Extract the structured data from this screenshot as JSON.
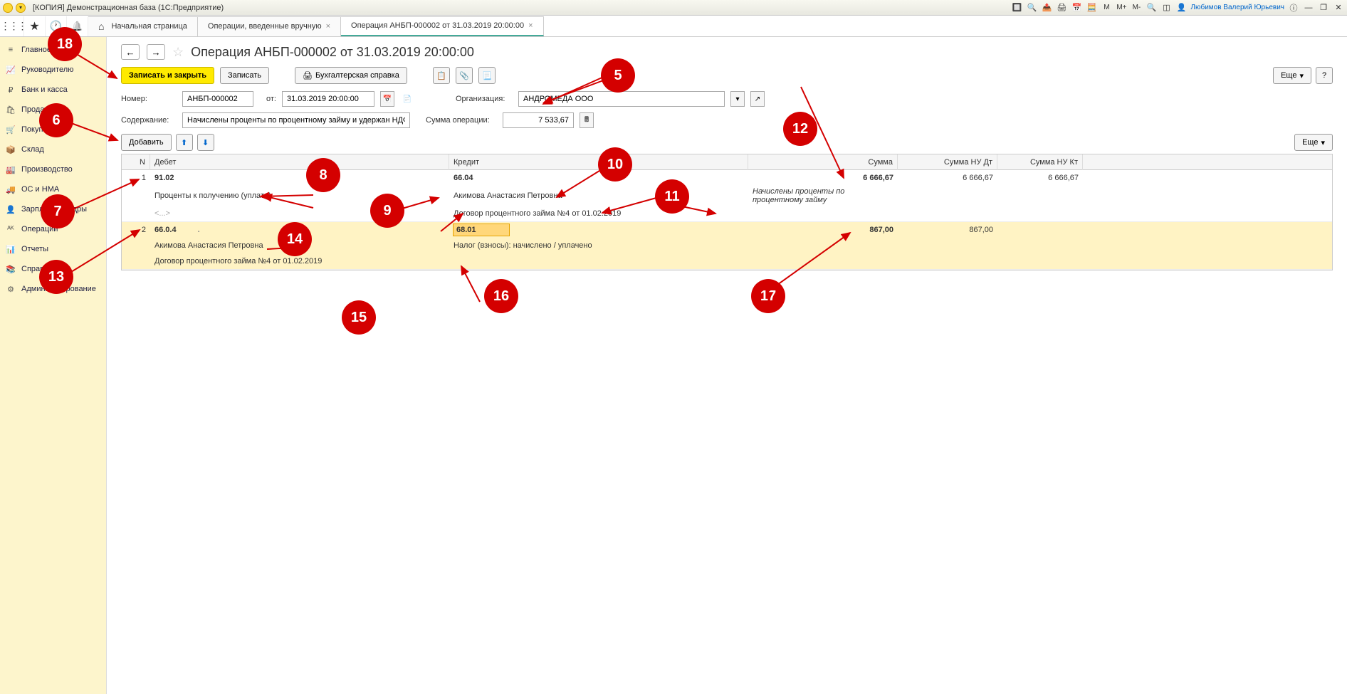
{
  "titlebar": {
    "title": "[КОПИЯ] Демонстрационная база  (1С:Предприятие)",
    "user": "Любимов Валерий Юрьевич",
    "m": "M",
    "mp": "M+",
    "mm": "M-"
  },
  "tabs": {
    "home": "Начальная страница",
    "t1": "Операции, введенные вручную",
    "t2": "Операция АНБП-000002 от 31.03.2019 20:00:00"
  },
  "sidebar": {
    "items": [
      {
        "icon": "≡",
        "label": "Главное"
      },
      {
        "icon": "📈",
        "label": "Руководителю"
      },
      {
        "icon": "₽",
        "label": "Банк и касса"
      },
      {
        "icon": "🛍",
        "label": "Продажи"
      },
      {
        "icon": "🛒",
        "label": "Покупки"
      },
      {
        "icon": "📦",
        "label": "Склад"
      },
      {
        "icon": "🏭",
        "label": "Производство"
      },
      {
        "icon": "🚚",
        "label": "ОС и НМА"
      },
      {
        "icon": "👤",
        "label": "Зарплата и кадры"
      },
      {
        "icon": "ᴬᴷ",
        "label": "Операции"
      },
      {
        "icon": "📊",
        "label": "Отчеты"
      },
      {
        "icon": "📚",
        "label": "Справочники"
      },
      {
        "icon": "⚙",
        "label": "Администрирование"
      }
    ]
  },
  "heading": "Операция АНБП-000002 от 31.03.2019 20:00:00",
  "toolbar": {
    "saveClose": "Записать и закрыть",
    "save": "Записать",
    "print": "Бухгалтерская справка",
    "more": "Еще"
  },
  "form": {
    "number_label": "Номер:",
    "number": "АНБП-000002",
    "date_label": "от:",
    "date": "31.03.2019 20:00:00",
    "org_label": "Организация:",
    "org": "АНДРОМЕДА ООО",
    "content_label": "Содержание:",
    "content": "Начислены проценты по процентному займу и удержан НДФЛ",
    "sum_label": "Сумма операции:",
    "sum": "7 533,67"
  },
  "subtoolbar": {
    "add": "Добавить",
    "more": "Еще"
  },
  "table": {
    "headers": {
      "n": "N",
      "debit": "Дебет",
      "credit": "Кредит",
      "sum": "Сумма",
      "sumdt": "Сумма НУ Дт",
      "sumkt": "Сумма НУ Кт"
    },
    "rows": [
      {
        "n": "1",
        "debit_acc": "91.02",
        "debit_sub1": "Проценты к получению (уплате)",
        "debit_sub2": "<...>",
        "credit_acc": "66.04",
        "credit_sub1": "Акимова Анастасия Петровна",
        "credit_sub2": "Договор процентного займа №4 от 01.02.2019",
        "sum": "6 666,67",
        "comment": "Начислены проценты по процентному займу",
        "sumdt": "6 666,67",
        "sumkt": "6 666,67"
      },
      {
        "n": "2",
        "debit_acc": "66.0.4",
        "debit_sub1": "Акимова Анастасия Петровна",
        "debit_sub2": "Договор процентного займа №4 от 01.02.2019",
        "credit_acc": "68.01",
        "credit_sub1": "Налог (взносы): начислено / уплачено",
        "credit_sub2": "",
        "sum": "867,00",
        "comment": "",
        "sumdt": "867,00",
        "sumkt": ""
      }
    ]
  },
  "annotations": {
    "a5": "5",
    "a6": "6",
    "a7": "7",
    "a8": "8",
    "a9": "9",
    "a10": "10",
    "a11": "11",
    "a12": "12",
    "a13": "13",
    "a14": "14",
    "a15": "15",
    "a16": "16",
    "a17": "17",
    "a18": "18"
  }
}
